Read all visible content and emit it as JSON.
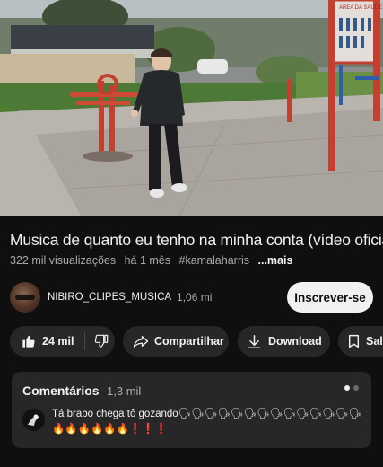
{
  "video": {
    "sign_text": "AREA DA SAUDE",
    "scene_icon": "outdoor-gym-scene"
  },
  "title": "Musica de quanto eu tenho na minha conta (vídeo oficial)",
  "meta": {
    "views": "322 mil visualizações",
    "age": "há 1 mês",
    "hashtag": "#kamalaharris",
    "more": "...mais"
  },
  "channel": {
    "name": "NIBIRO_CLIPES_MUSICA",
    "subscribers": "1,06 mi",
    "subscribe_label": "Inscrever-se"
  },
  "actions": {
    "likes": "24 mil",
    "like_icon": "thumb-up-icon",
    "dislike_icon": "thumb-down-icon",
    "share_label": "Compartilhar",
    "share_icon": "share-arrow-icon",
    "download_label": "Download",
    "download_icon": "download-icon",
    "save_label": "Salvar",
    "save_icon": "bookmark-icon"
  },
  "comments": {
    "title": "Comentários",
    "count": "1,3 mil",
    "top_comment": "Tá brabo chega tô gozando🗣🗣🗣🗣🗣🗣🗣🗣🗣🗣🗣🗣🗣🗣🔥🔥🔥🔥🔥🔥❗❗❗"
  },
  "colors": {
    "background": "#0f0f0f",
    "chip": "#272727",
    "text_primary": "#f1f1f1",
    "text_secondary": "#aaaaaa",
    "subscribe_bg": "#f1f1f1"
  }
}
